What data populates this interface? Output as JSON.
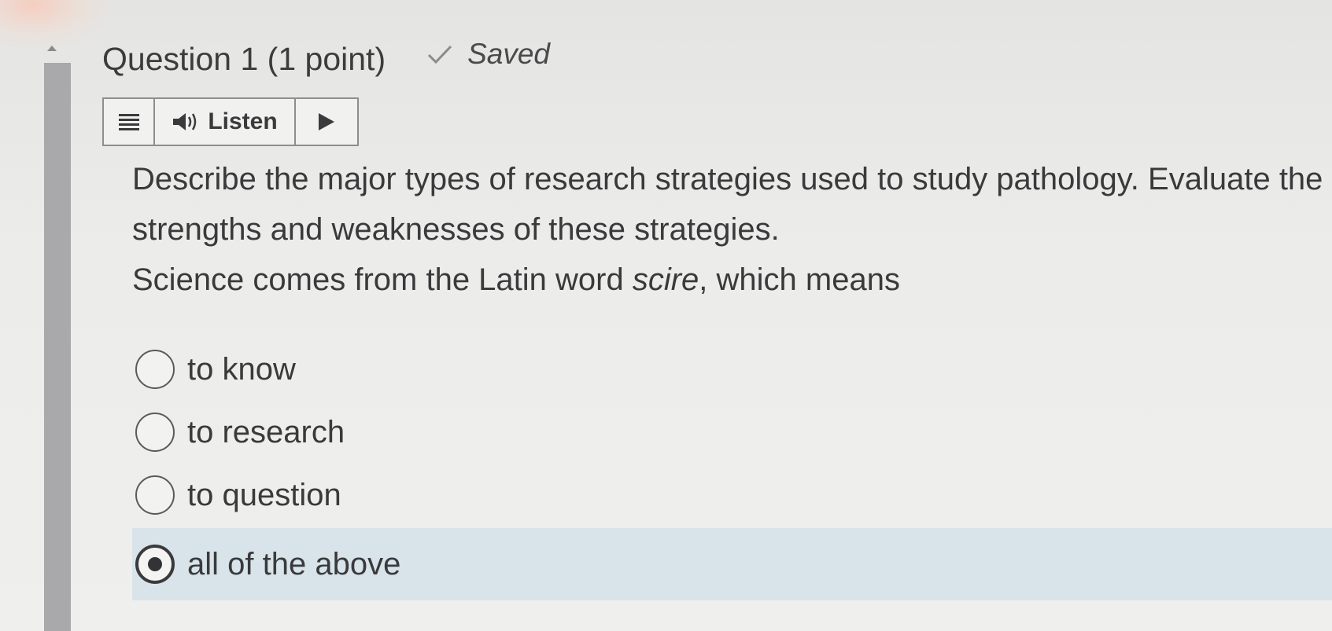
{
  "question": {
    "title": "Question 1 (1 point)",
    "status_icon": "check-icon",
    "status": "Saved"
  },
  "listen_toolbar": {
    "menu_icon": "menu-lines-icon",
    "speaker_icon": "speaker-icon",
    "listen_label": "Listen",
    "play_icon": "play-icon"
  },
  "prompt": {
    "line1": "Describe the major types of research strategies used to study pathology. Evaluate the strengths and weaknesses of these strategies.",
    "line2_before": "Science comes from the Latin word ",
    "line2_italic": "scire",
    "line2_after": ", which means"
  },
  "options": [
    {
      "label": "to know",
      "selected": false
    },
    {
      "label": "to research",
      "selected": false
    },
    {
      "label": "to question",
      "selected": false
    },
    {
      "label": "all of the above",
      "selected": true
    }
  ],
  "colors": {
    "selected_row": "#d8e4ea",
    "rail": "#a9a9ab",
    "text": "#3a3a3c"
  }
}
